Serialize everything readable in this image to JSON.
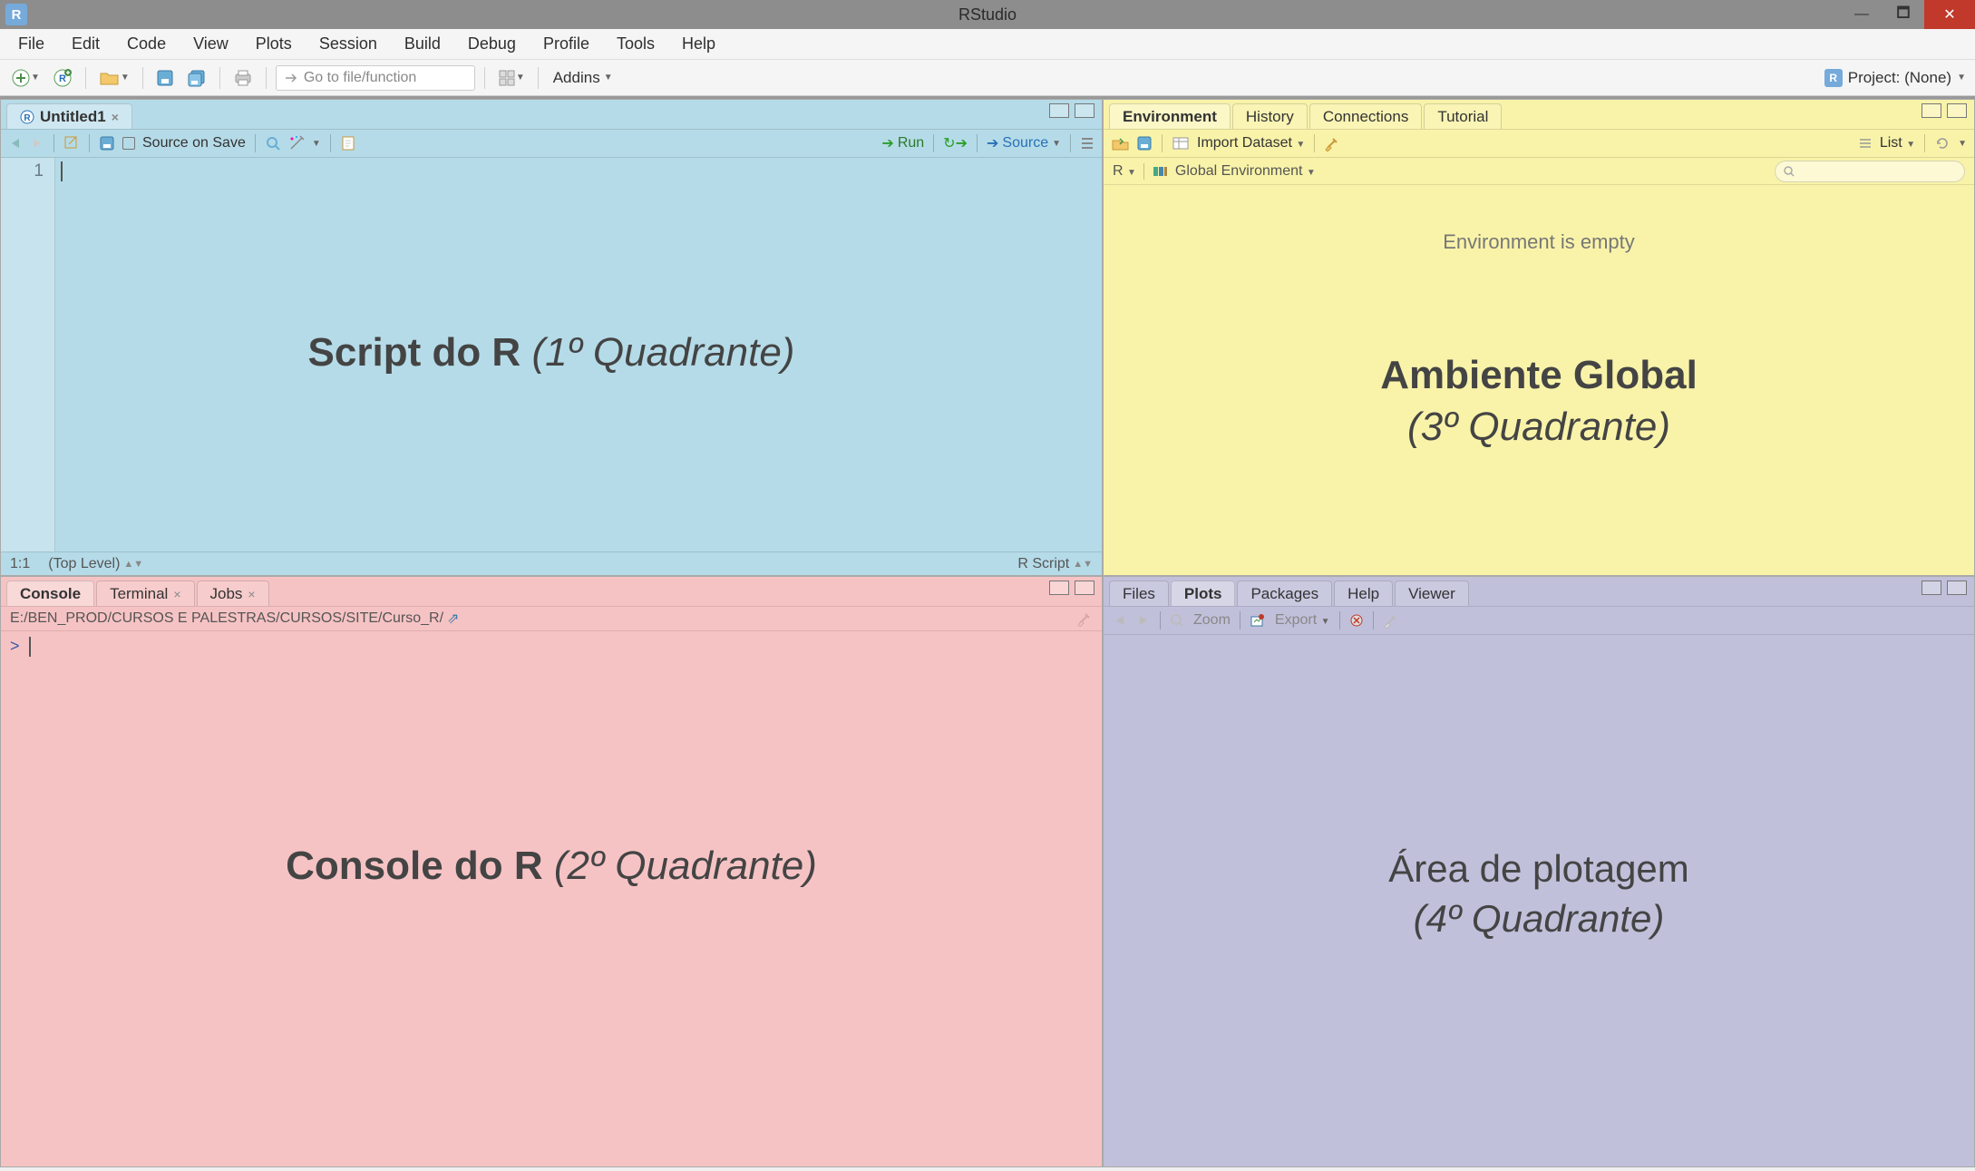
{
  "titlebar": {
    "app_icon_letter": "R",
    "title": "RStudio"
  },
  "menubar": {
    "items": [
      "File",
      "Edit",
      "Code",
      "View",
      "Plots",
      "Session",
      "Build",
      "Debug",
      "Profile",
      "Tools",
      "Help"
    ]
  },
  "toolbar": {
    "goto_placeholder": "Go to file/function",
    "addins_label": "Addins",
    "project_label": "Project: (None)"
  },
  "q1": {
    "tab_label": "Untitled1",
    "source_on_save": "Source on Save",
    "run_label": "Run",
    "source_label": "Source",
    "line_number": "1",
    "cursor_pos": "1:1",
    "scope_label": "(Top Level)",
    "lang_label": "R Script",
    "overlay_bold": "Script do R",
    "overlay_ital": "(1º Quadrante)"
  },
  "q2": {
    "tabs": [
      "Console",
      "Terminal",
      "Jobs"
    ],
    "path": "E:/BEN_PROD/CURSOS E PALESTRAS/CURSOS/SITE/Curso_R/",
    "prompt": ">",
    "overlay_bold": "Console do R",
    "overlay_ital": "(2º Quadrante)"
  },
  "q3": {
    "tabs": [
      "Environment",
      "History",
      "Connections",
      "Tutorial"
    ],
    "import_label": "Import Dataset",
    "list_label": "List",
    "scope_r": "R",
    "scope_env": "Global Environment",
    "empty_msg": "Environment is empty",
    "overlay_bold": "Ambiente Global",
    "overlay_ital": "(3º Quadrante)"
  },
  "q4": {
    "tabs": [
      "Files",
      "Plots",
      "Packages",
      "Help",
      "Viewer"
    ],
    "zoom_label": "Zoom",
    "export_label": "Export",
    "overlay_bold": "Área de plotagem",
    "overlay_ital": "(4º Quadrante)"
  }
}
